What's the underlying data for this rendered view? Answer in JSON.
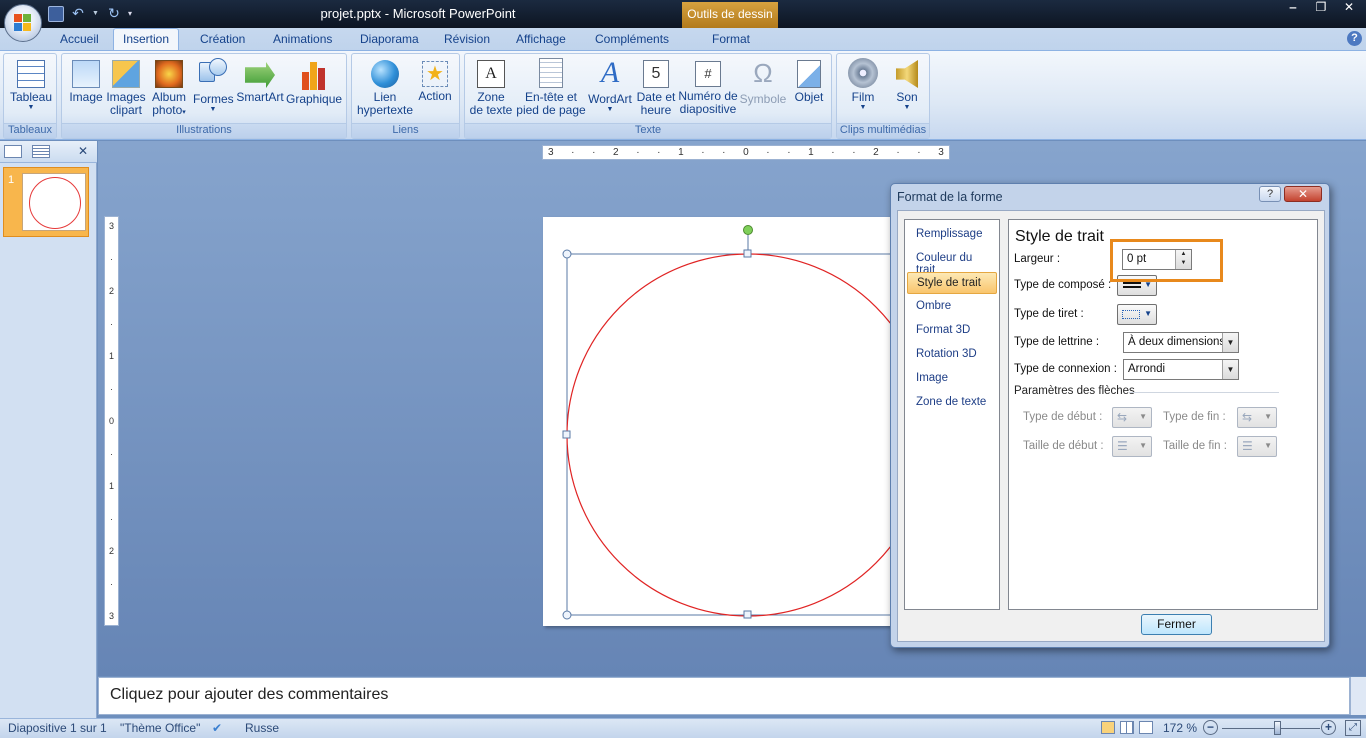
{
  "window": {
    "title": "projet.pptx - Microsoft PowerPoint",
    "contextual_tab_group": "Outils de dessin",
    "minimize": "‒",
    "restore": "❐",
    "close": "✕"
  },
  "tabs": [
    "Accueil",
    "Insertion",
    "Création",
    "Animations",
    "Diaporama",
    "Révision",
    "Affichage",
    "Compléments",
    "Format"
  ],
  "active_tab": "Insertion",
  "ribbon": {
    "groups": {
      "tableaux": "Tableaux",
      "illustrations": "Illustrations",
      "liens": "Liens",
      "texte": "Texte",
      "clips": "Clips multimédias"
    },
    "buttons": {
      "tableau": "Tableau",
      "image": "Image",
      "images_clipart_1": "Images",
      "images_clipart_2": "clipart",
      "album_1": "Album",
      "album_2": "photo",
      "formes": "Formes",
      "smartart": "SmartArt",
      "graphique": "Graphique",
      "lien_1": "Lien",
      "lien_2": "hypertexte",
      "action": "Action",
      "zone_1": "Zone",
      "zone_2": "de texte",
      "entete_1": "En-tête et",
      "entete_2": "pied de page",
      "wordart": "WordArt",
      "date_1": "Date et",
      "date_2": "heure",
      "numero_1": "Numéro de",
      "numero_2": "diapositive",
      "symbole": "Symbole",
      "objet": "Objet",
      "film": "Film",
      "son": "Son"
    }
  },
  "left_pane": {
    "slide_number": "1"
  },
  "ruler": {
    "h_ticks": [
      "3",
      "2",
      "1",
      "0",
      "1",
      "2",
      "3"
    ],
    "v_ticks": [
      "3",
      "2",
      "1",
      "0",
      "1",
      "2",
      "3"
    ]
  },
  "notes": {
    "placeholder": "Cliquez pour ajouter des commentaires"
  },
  "status": {
    "slide": "Diapositive 1 sur 1",
    "theme": "\"Thème Office\"",
    "language": "Russe",
    "zoom": "172 %"
  },
  "dialog": {
    "title": "Format de la forme",
    "help": "?",
    "close": "✕",
    "nav": [
      "Remplissage",
      "Couleur du trait",
      "Style de trait",
      "Ombre",
      "Format 3D",
      "Rotation 3D",
      "Image",
      "Zone de texte"
    ],
    "selected_nav": "Style de trait",
    "panel_title": "Style de trait",
    "largeur_label": "Largeur :",
    "largeur_value": "0 pt",
    "compose_label": "Type de composé :",
    "tiret_label": "Type de tiret :",
    "lettrine_label": "Type de lettrine :",
    "lettrine_value": "À deux dimensions",
    "connexion_label": "Type de connexion :",
    "connexion_value": "Arrondi",
    "fleches_section": "Paramètres des flèches",
    "type_debut": "Type de début :",
    "type_fin": "Type de fin :",
    "taille_debut": "Taille de début :",
    "taille_fin": "Taille de fin :",
    "fermer": "Fermer"
  },
  "colors": {
    "circle_stroke": "#e02424",
    "highlight": "#e8891c",
    "selected_nav": "#f9c56d"
  }
}
